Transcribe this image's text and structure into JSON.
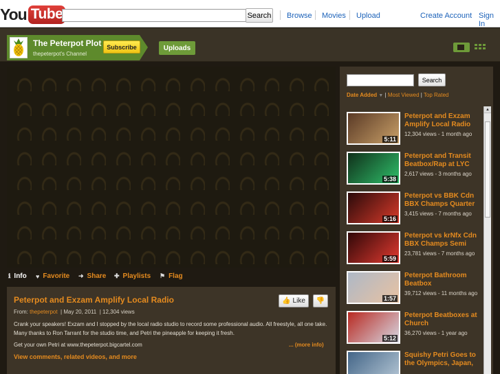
{
  "masthead": {
    "logo_you": "You",
    "logo_tube": "Tube",
    "search_value": "",
    "search_button": "Search",
    "nav": [
      "Browse",
      "Movies",
      "Upload"
    ],
    "create_account": "Create Account",
    "sign_in": "Sign In"
  },
  "channel": {
    "title": "The Peterpot Plot",
    "subtitle": "thepeterpot's Channel",
    "subscribe_label": "Subscribe",
    "uploads_tab": "Uploads",
    "accent_color": "#5e8a2c"
  },
  "actions": {
    "info": "Info",
    "favorite": "Favorite",
    "share": "Share",
    "playlists": "Playlists",
    "flag": "Flag"
  },
  "video": {
    "title": "Peterpot and Exzam Amplify Local Radio",
    "like_label": "Like",
    "from_label": "From:",
    "uploader": "thepeterpot",
    "date": "May 20, 2011",
    "views": "12,304 views",
    "description": "Crank your speakers! Exzam and I stopped by the local radio studio to record some professional audio. All freestyle, all one take. Many thanks to Ron Tarrant for the studio time, and Petri the pineapple for keeping it fresh.",
    "description2": "Get your own Petri at www.thepeterpot.bigcartel.com",
    "more_info": "... (more info)",
    "view_comments": "View comments, related videos, and more"
  },
  "sidebar": {
    "search_value": "",
    "search_button": "Search",
    "sort_date": "Date Added",
    "sort_viewed": "Most Viewed",
    "sort_rated": "Top Rated",
    "videos": [
      {
        "title": "Peterpot and Exzam Amplify Local Radio",
        "meta": "12,304 views - 1 month ago",
        "duration": "5:11",
        "colors": [
          "#5a3a26",
          "#c9a068"
        ]
      },
      {
        "title": "Peterpot and Transit Beatbox/Rap at LYC",
        "meta": "2,617 views - 3 months ago",
        "duration": "5:38",
        "colors": [
          "#10301a",
          "#2fbf6a"
        ]
      },
      {
        "title": "Peterpot vs BBK Cdn BBX Champs Quarter",
        "meta": "3,415 views - 7 months ago",
        "duration": "5:16",
        "colors": [
          "#2a0a0a",
          "#d83a2a"
        ]
      },
      {
        "title": "Peterpot vs krNfx Cdn BBX Champs Semi",
        "meta": "23,781 views - 7 months ago",
        "duration": "5:59",
        "colors": [
          "#300808",
          "#e23a30"
        ]
      },
      {
        "title": "Peterpot Bathroom Beatbox",
        "meta": "39,712 views - 11 months ago",
        "duration": "1:57",
        "colors": [
          "#aeb8c6",
          "#e8c2a2"
        ]
      },
      {
        "title": "Peterpot Beatboxes at Church",
        "meta": "36,270 views - 1 year ago",
        "duration": "5:12",
        "colors": [
          "#b82a22",
          "#d7d7e2"
        ]
      },
      {
        "title": "Squishy Petri Goes to the Olympics, Japan,",
        "meta": "",
        "duration": "",
        "colors": [
          "#446688",
          "#b7c8d6"
        ]
      }
    ]
  }
}
